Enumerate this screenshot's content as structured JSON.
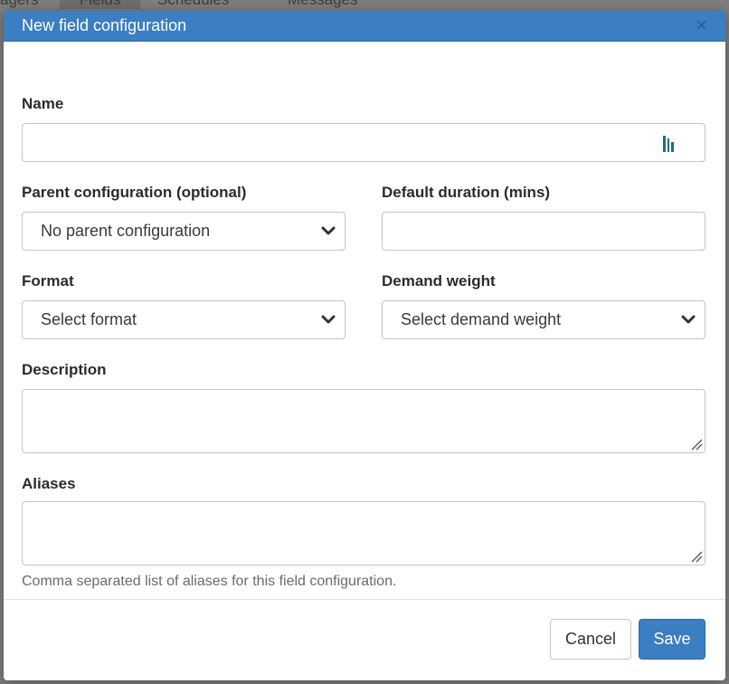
{
  "background": {
    "tabs": [
      "agers",
      "Fields",
      "Schedules",
      "Messages"
    ]
  },
  "modal": {
    "title": "New field configuration",
    "close_glyph": "×"
  },
  "form": {
    "name_label": "Name",
    "name_value": "",
    "parent_label": "Parent configuration (optional)",
    "parent_selected": "No parent configuration",
    "duration_label": "Default duration (mins)",
    "duration_value": "",
    "format_label": "Format",
    "format_selected": "Select format",
    "demand_label": "Demand weight",
    "demand_selected": "Select demand weight",
    "description_label": "Description",
    "aliases_label": "Aliases",
    "aliases_help": "Comma separated list of aliases for this field configuration."
  },
  "footer": {
    "cancel_label": "Cancel",
    "save_label": "Save"
  },
  "colors": {
    "header_bg": "#3b7ec2",
    "primary_button": "#3b7ec2",
    "password_manager_icon": "#1f6f7a"
  },
  "icons": {
    "close": "close-icon",
    "select_arrow": "chevron-down-icon",
    "autofill": "password-manager-icon",
    "resize": "resize-grip-icon"
  }
}
